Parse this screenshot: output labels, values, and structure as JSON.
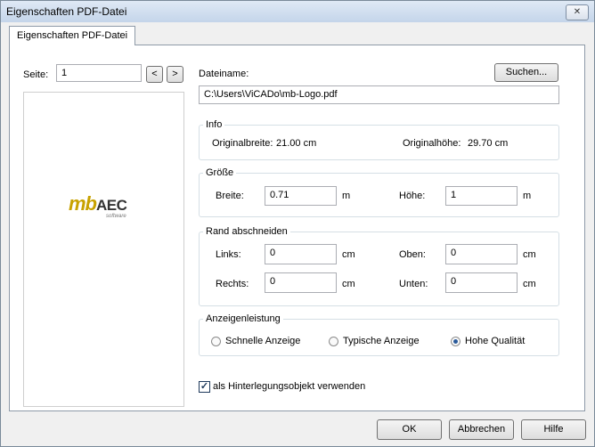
{
  "window": {
    "title": "Eigenschaften PDF-Datei",
    "close_glyph": "✕"
  },
  "tab": {
    "label": "Eigenschaften PDF-Datei"
  },
  "page": {
    "label": "Seite:",
    "value": "1",
    "prev": "<",
    "next": ">"
  },
  "logo": {
    "mb": "mb",
    "aec": "AEC",
    "sub": "software",
    "color_primary": "#c8a200",
    "color_dark": "#333333"
  },
  "file": {
    "label": "Dateiname:",
    "search_button": "Suchen...",
    "path": "C:\\Users\\ViCADo\\mb-Logo.pdf"
  },
  "info": {
    "legend": "Info",
    "width_label": "Originalbreite:",
    "width_value": "21.00 cm",
    "height_label": "Originalhöhe:",
    "height_value": "29.70 cm"
  },
  "size": {
    "legend": "Größe",
    "width_label": "Breite:",
    "width_value": "0.71",
    "width_unit": "m",
    "height_label": "Höhe:",
    "height_value": "1",
    "height_unit": "m"
  },
  "crop": {
    "legend": "Rand abschneiden",
    "left_label": "Links:",
    "left_value": "0",
    "left_unit": "cm",
    "top_label": "Oben:",
    "top_value": "0",
    "top_unit": "cm",
    "right_label": "Rechts:",
    "right_value": "0",
    "right_unit": "cm",
    "bottom_label": "Unten:",
    "bottom_value": "0",
    "bottom_unit": "cm"
  },
  "display": {
    "legend": "Anzeigenleistung",
    "options": [
      {
        "label": "Schnelle Anzeige",
        "selected": false
      },
      {
        "label": "Typische Anzeige",
        "selected": false
      },
      {
        "label": "Hohe Qualität",
        "selected": true
      }
    ]
  },
  "background_object": {
    "checked": true,
    "check_glyph": "✓",
    "label": "als Hinterlegungsobjekt verwenden"
  },
  "footer": {
    "ok": "OK",
    "cancel": "Abbrechen",
    "help": "Hilfe"
  }
}
